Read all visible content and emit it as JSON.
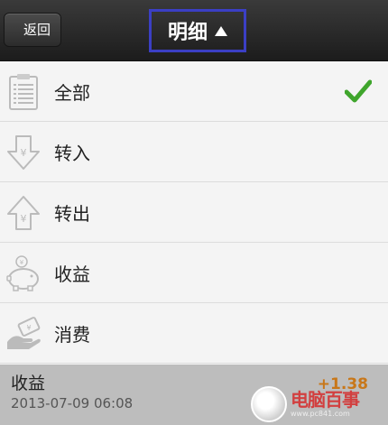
{
  "header": {
    "back_label": "返回",
    "title": "明细"
  },
  "menu": {
    "items": [
      {
        "label": "全部",
        "icon": "clipboard-list-icon",
        "selected": true
      },
      {
        "label": "转入",
        "icon": "arrow-down-yen-icon",
        "selected": false
      },
      {
        "label": "转出",
        "icon": "arrow-up-yen-icon",
        "selected": false
      },
      {
        "label": "收益",
        "icon": "piggy-bank-icon",
        "selected": false
      },
      {
        "label": "消费",
        "icon": "cash-hand-icon",
        "selected": false
      }
    ]
  },
  "record": {
    "title": "收益",
    "date": "2013-07-09 06:08",
    "amount": "+1.38"
  },
  "watermark": {
    "brand": "电脑百事",
    "url": "www.pc841.com"
  },
  "colors": {
    "header_bg": "#2a2a2a",
    "title_border": "#3b3fc4",
    "check": "#3fa52c",
    "amount": "#c87719",
    "record_bg": "#bdbdbd"
  }
}
